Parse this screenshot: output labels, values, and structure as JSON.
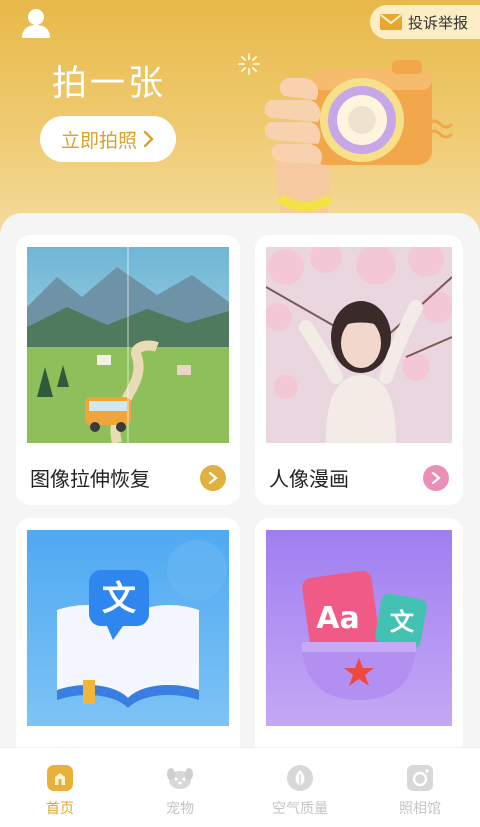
{
  "header": {
    "report_label": "投诉举报",
    "title": "拍一张",
    "shoot_button_label": "立即拍照"
  },
  "cards": [
    {
      "label": "图像拉伸恢复",
      "accent": "#e0b040"
    },
    {
      "label": "人像漫画",
      "accent": "#ec8fb6"
    },
    {
      "label": "",
      "accent": "#4b9ff0"
    },
    {
      "label": "",
      "accent": "#b48ff2"
    }
  ],
  "tabs": [
    {
      "label": "首页",
      "icon": "home-icon",
      "active": true
    },
    {
      "label": "宠物",
      "icon": "pet-icon",
      "active": false
    },
    {
      "label": "空气质量",
      "icon": "leaf-icon",
      "active": false
    },
    {
      "label": "照相馆",
      "icon": "camera-icon",
      "active": false
    }
  ],
  "colors": {
    "brand": "#e8b94a",
    "accent_text": "#d9a22c",
    "active_tab": "#e2a530"
  }
}
